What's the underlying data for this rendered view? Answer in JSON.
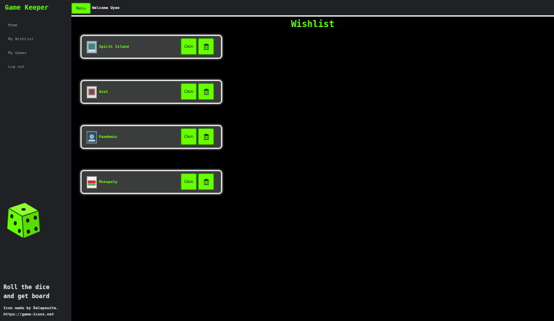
{
  "app": {
    "title": "Game Keeper"
  },
  "sidebar": {
    "items": [
      {
        "label": "Home"
      },
      {
        "label": "My Wishlist"
      },
      {
        "label": "My Games"
      },
      {
        "label": "Log out"
      }
    ],
    "dice_icon": "dice-icon",
    "tagline_line1": "Roll the dice",
    "tagline_line2": "and get board",
    "credit_line1": "Icon made by Delapouite.",
    "credit_line2": "https://game-icons.net"
  },
  "topbar": {
    "menu_label": "Menu",
    "welcome_text": "Welcome Uyen"
  },
  "main": {
    "title": "Wishlist",
    "own_label": "Own",
    "delete_icon": "trash-icon",
    "games": [
      {
        "name": "Spirit Island"
      },
      {
        "name": "Azul"
      },
      {
        "name": "Pandemic"
      },
      {
        "name": "Monopoly"
      }
    ]
  },
  "colors": {
    "accent": "#66ff00",
    "sidebar_bg": "#1f2124",
    "card_bg": "#3a3d3c",
    "page_bg": "#000000"
  }
}
